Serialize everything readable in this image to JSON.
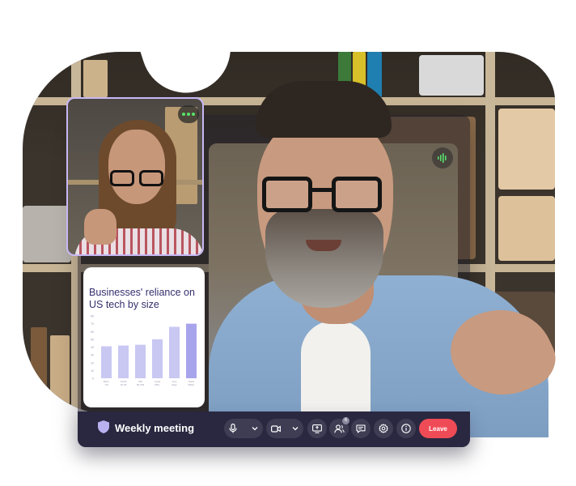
{
  "meeting": {
    "title": "Weekly meeting",
    "leave_label": "Leave",
    "participants_count": "6"
  },
  "participants": [
    {
      "role": "active-speaker",
      "icon": "audio-wave-icon"
    },
    {
      "role": "thumbnail",
      "icon": "more-dots-icon"
    }
  ],
  "controls": [
    {
      "name": "mic-toggle",
      "icon": "microphone-icon"
    },
    {
      "name": "mic-options",
      "icon": "chevron-down-icon"
    },
    {
      "name": "camera-toggle",
      "icon": "video-camera-icon"
    },
    {
      "name": "camera-options",
      "icon": "chevron-down-icon"
    },
    {
      "name": "share-screen",
      "icon": "screen-share-icon"
    },
    {
      "name": "participants",
      "icon": "people-icon"
    },
    {
      "name": "chat",
      "icon": "chat-icon"
    },
    {
      "name": "settings",
      "icon": "gear-icon"
    },
    {
      "name": "info",
      "icon": "info-icon"
    }
  ],
  "colors": {
    "accent": "#c7b8f5",
    "bar_bg": "#2a2840",
    "leave": "#ef4b56",
    "chart_bar": "#c9c8f3",
    "chart_bar_highlight": "#a8a4ec",
    "chart_title": "#34306e"
  },
  "chart_data": {
    "type": "bar",
    "title": "Businesses' reliance on US tech by size",
    "categories": [
      "Micro\n<10",
      "Small\n10-49",
      "Mid\n50-249",
      "Large\n250+",
      "Very\nlarge",
      "Giant\n5000+"
    ],
    "values": [
      41,
      42,
      43,
      50,
      66,
      70
    ],
    "ylim": [
      0,
      80
    ],
    "yticks": [
      0,
      10,
      20,
      30,
      40,
      50,
      60,
      70,
      80
    ],
    "highlight_index": 5
  }
}
